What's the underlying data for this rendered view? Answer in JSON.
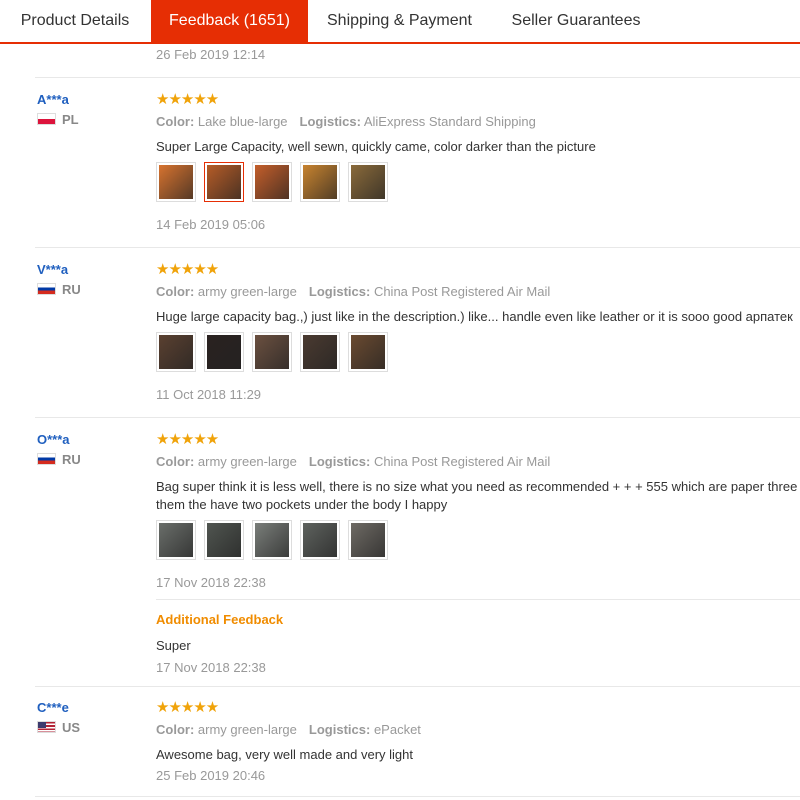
{
  "tabs": {
    "details": "Product Details",
    "feedback": "Feedback (1651)",
    "shipping": "Shipping & Payment",
    "guarantees": "Seller Guarantees"
  },
  "top_date": "26 Feb 2019 12:14",
  "labels": {
    "color": "Color:",
    "logistics": "Logistics:",
    "additional": "Additional Feedback"
  },
  "stars": "★★★★★",
  "colors": {
    "accent": "#e62e04",
    "star": "#f0a30a",
    "user": "#1f5fbf",
    "additional": "#f08c00"
  },
  "feedbacks": [
    {
      "user": "A***a",
      "country": "PL",
      "color": "Lake blue-large",
      "logistics": "AliExpress Standard Shipping",
      "text": "Super Large Capacity, well sewn, quickly came, color darker than the picture",
      "photo_colors": [
        "#d7732f",
        "#b65c27",
        "#c45e2a",
        "#c8832f",
        "#8a6a3a"
      ],
      "date": "14 Feb 2019 05:06"
    },
    {
      "user": "V***a",
      "country": "RU",
      "color": "army green-large",
      "logistics": "China Post Registered Air Mail",
      "text": "Huge large capacity bag.,) just like in the description.) like... handle even like leather or it is sooo good арпатек",
      "photo_colors": [
        "#5a4030",
        "#2a2220",
        "#6b5040",
        "#4a3a30",
        "#6a4a30"
      ],
      "date": "11 Oct 2018 11:29"
    },
    {
      "user": "O***a",
      "country": "RU",
      "color": "army green-large",
      "logistics": "China Post Registered Air Mail",
      "text": "Bag super think it is less well, there is no size what you need as recommended + + + 555 which are paper three them the have two pockets under the body I happy",
      "photo_colors": [
        "#6a6e6a",
        "#505550",
        "#7a7e7a",
        "#5e625e",
        "#6e6a64"
      ],
      "date": "17 Nov 2018 22:38",
      "additional_text": "Super",
      "additional_date": "17 Nov 2018 22:38"
    },
    {
      "user": "C***e",
      "country": "US",
      "color": "army green-large",
      "logistics": "ePacket",
      "text": "Awesome bag, very well made and very light",
      "date": "25 Feb 2019 20:46"
    }
  ]
}
